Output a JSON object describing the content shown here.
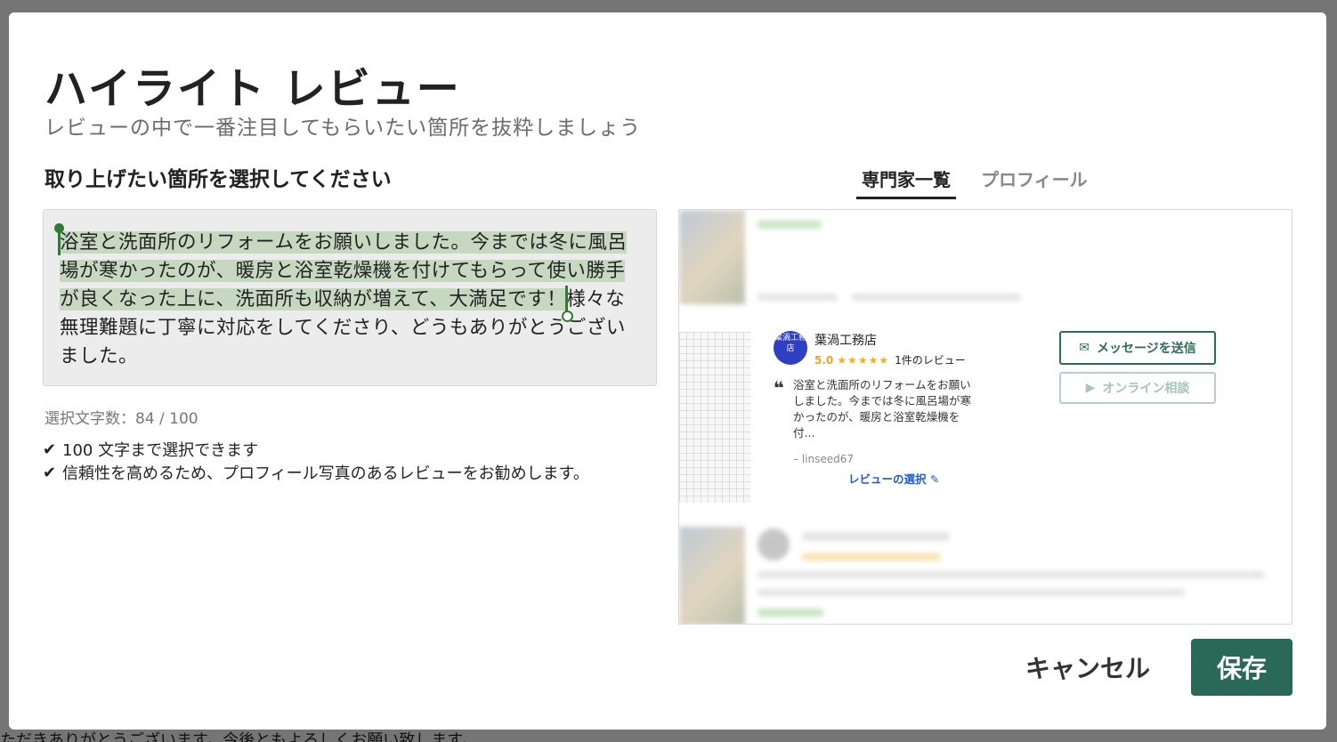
{
  "background": {
    "bottom_text": "ただきありがとうございます。今後ともよろしくお願い致します。"
  },
  "dialog": {
    "title": "ハイライト レビュー",
    "subtitle": "レビューの中で一番注目してもらいたい箇所を抜粋しましょう",
    "section_label": "取り上げたい箇所を選択してください",
    "review_text_selected": "浴室と洗面所のリフォームをお願いしました。今までは冬に風呂場が寒かったのが、暖房と浴室乾燥機を付けてもらって使い勝手が良くなった上に、洗面所も収納が増えて、大満足です！",
    "review_text_rest": "様々な無理難題に丁寧に対応をしてくださり、どうもありがとうございました。",
    "char_count_label": "選択文字数：84 / 100",
    "rules": [
      "100 文字まで選択できます",
      "信頼性を高めるため、プロフィール写真のあるレビューをお勧めします。"
    ],
    "cancel_label": "キャンセル",
    "save_label": "保存"
  },
  "preview": {
    "tabs": [
      {
        "label": "専門家一覧",
        "active": true
      },
      {
        "label": "プロフィール",
        "active": false
      }
    ],
    "card": {
      "avatar_text": "葉渦工務店",
      "company_name": "葉渦工務店",
      "rating": "5.0",
      "stars": "★★★★★",
      "review_count": "1件のレビュー",
      "quote_mark": "❝",
      "snippet": "浴室と洗面所のリフォームをお願いしました。今までは冬に風呂場が寒かったのが、暖房と浴室乾燥機を付...",
      "reviewer": "– linseed67",
      "select_link": "レビューの選択 ✎",
      "message_button": "メッセージを送信",
      "online_button": "オンライン相談"
    }
  },
  "colors": {
    "accent": "#2a6957",
    "highlight": "#c6d9c0",
    "link": "#1c5bd6",
    "star": "#f2b01e"
  }
}
